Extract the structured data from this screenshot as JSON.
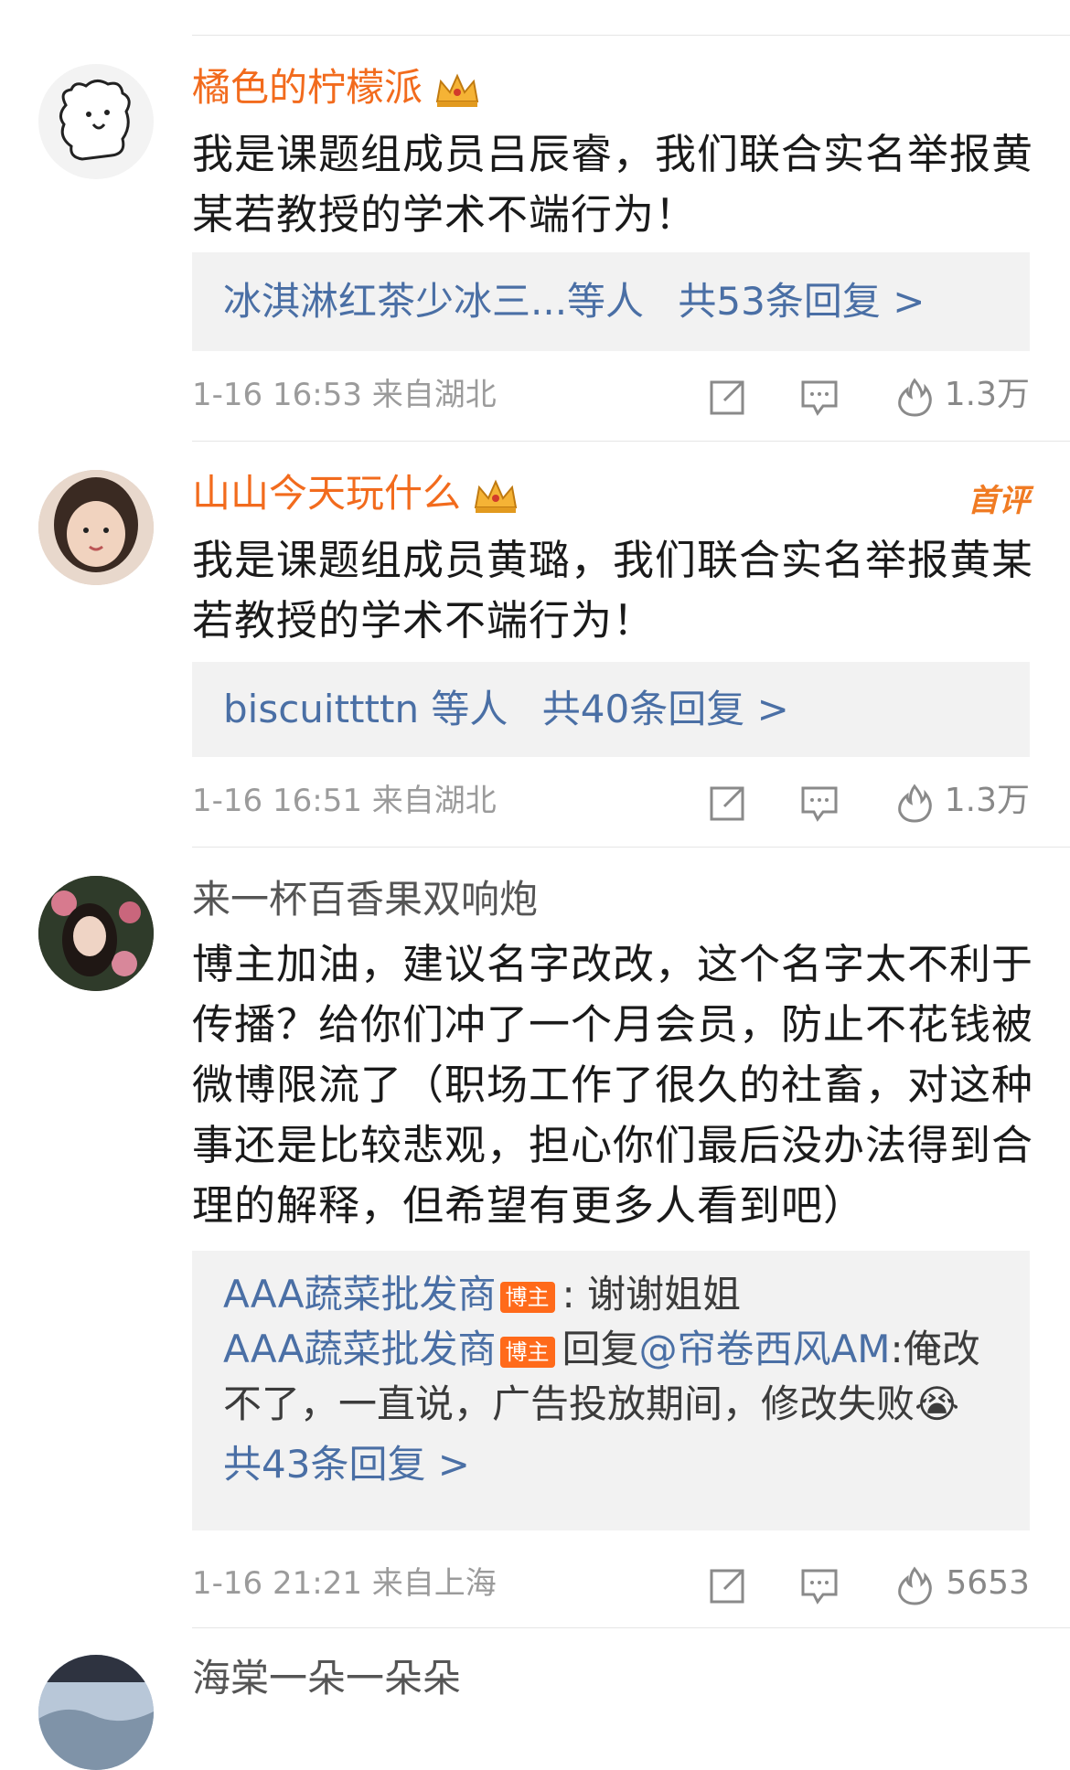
{
  "comments": [
    {
      "username": "橘色的柠檬派",
      "text": "我是课题组成员吕辰睿，我们联合实名举报黄某若教授的学术不端行为！",
      "reply_preview": "冰淇淋红茶少冰三...等人",
      "reply_count": "共53条回复 >",
      "time": "1-16 16:53",
      "location": "来自湖北",
      "likes": "1.3万"
    },
    {
      "username": "山山今天玩什么",
      "first_badge": "首评",
      "text": "我是课题组成员黄璐，我们联合实名举报黄某若教授的学术不端行为！",
      "reply_preview": "biscuittttn 等人",
      "reply_count": "共40条回复 >",
      "time": "1-16 16:51",
      "location": "来自湖北",
      "likes": "1.3万"
    },
    {
      "username": "来一杯百香果双响炮",
      "text": "博主加油，建议名字改改，这个名字太不利于传播？给你们冲了一个月会员，防止不花钱被微博限流了（职场工作了很久的社畜，对这种事还是比较悲观，担心你们最后没办法得到合理的解释，但希望有更多人看到吧）",
      "replies": [
        {
          "user": "AAA蔬菜批发商",
          "badge": "博主",
          "content": ": 谢谢姐姐"
        },
        {
          "user": "AAA蔬菜批发商",
          "badge": "博主",
          "reply_word": "回复",
          "mention": "@帘卷西风AM",
          "content": ":俺改不了，一直说，广告投放期间，修改失败😭"
        }
      ],
      "reply_count": "共43条回复 >",
      "time": "1-16 21:21",
      "location": "来自上海",
      "likes": "5653"
    },
    {
      "username": "海棠一朵一朵朵"
    }
  ],
  "icons": {
    "repost": "share-icon",
    "comment": "comment-icon",
    "like": "flame-like-icon",
    "crown": "crown-icon"
  },
  "colors": {
    "username_orange": "#f26b1d",
    "link_blue": "#4a6fa5",
    "host_badge": "#ff6a1a",
    "meta_gray": "#9b9b9b"
  }
}
